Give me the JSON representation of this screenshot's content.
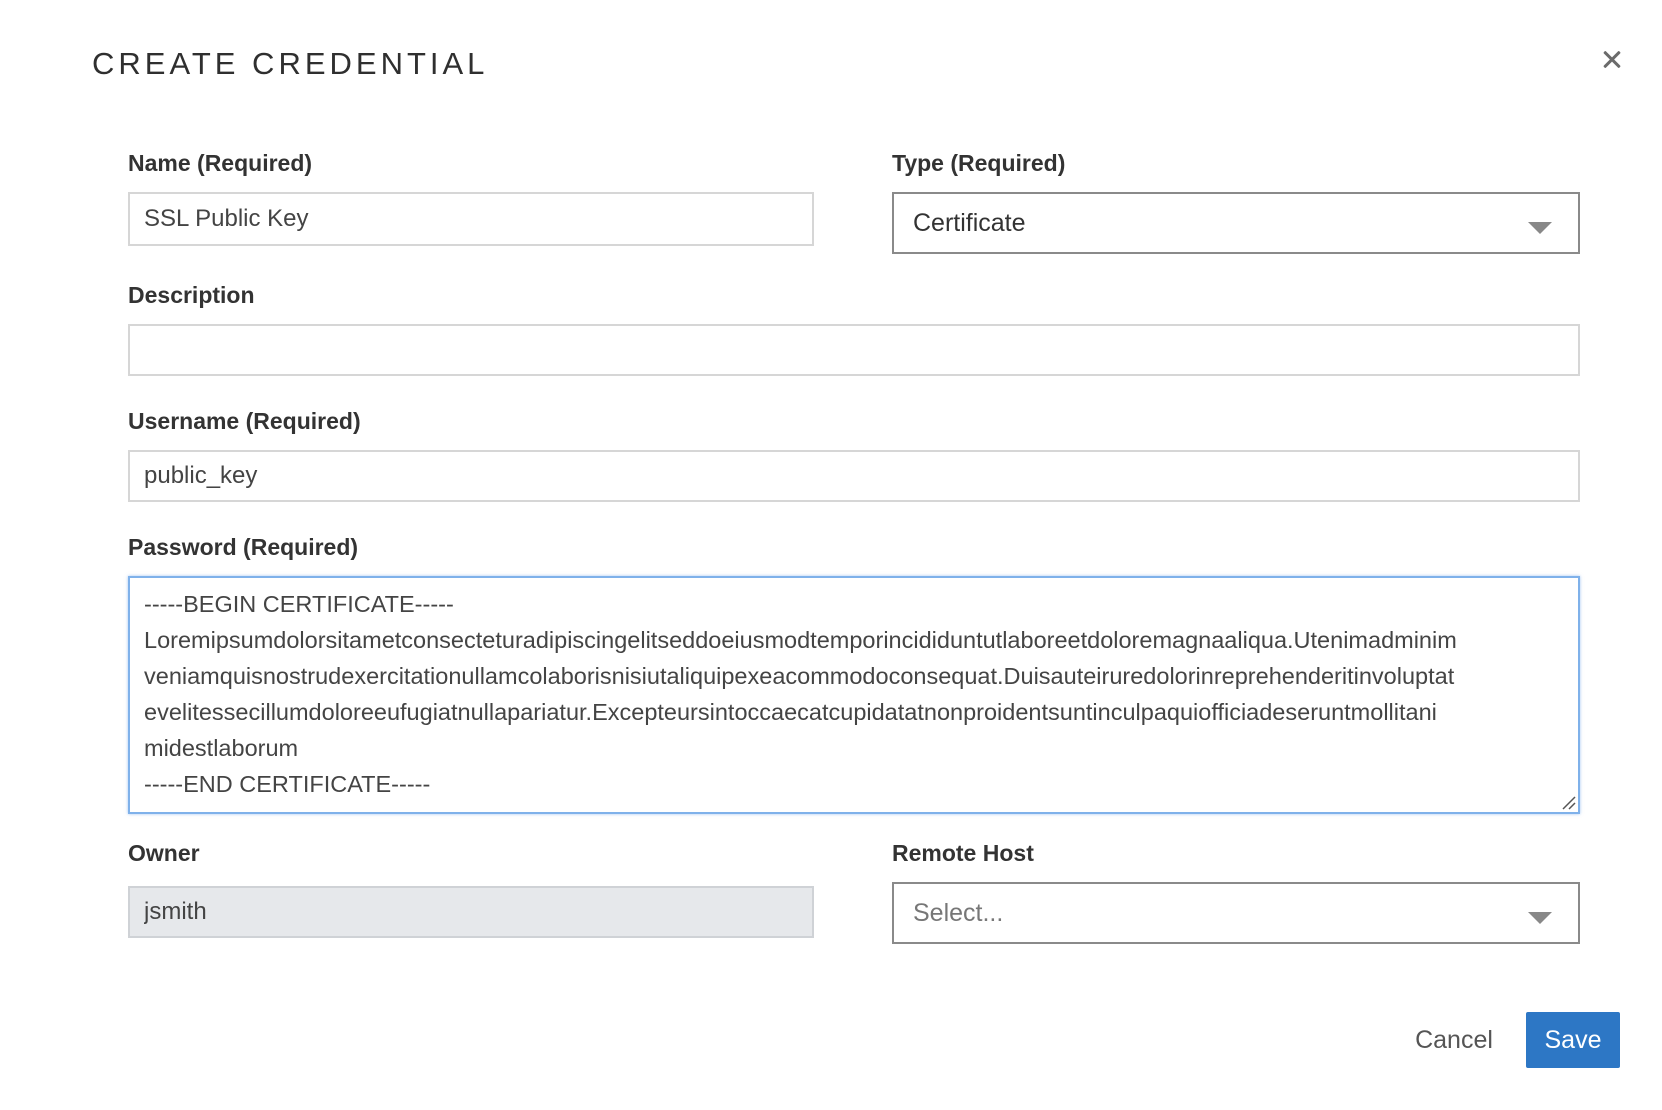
{
  "dialog": {
    "title": "CREATE CREDENTIAL",
    "close_icon": "close-icon"
  },
  "form": {
    "name": {
      "label": "Name (Required)",
      "value": "SSL Public Key"
    },
    "type": {
      "label": "Type (Required)",
      "selected": "Certificate",
      "icon": "chevron-down-icon"
    },
    "description": {
      "label": "Description",
      "value": ""
    },
    "username": {
      "label": "Username (Required)",
      "value": "public_key"
    },
    "password": {
      "label": "Password (Required)",
      "lines": [
        "-----BEGIN CERTIFICATE-----",
        "Loremipsumdolorsitametconsecteturadipiscingelitseddoeiusmodtemporincididuntutlaboreetdoloremagnaaliqua.Utenimadminim",
        "veniamquisnostrudexercitationullamcolaborisnisiutaliquipexeacommodoconsequat.Duisauteiruredolorinreprehenderitinvoluptat",
        "evelitessecillumdoloreeufugiatnullapariatur.Excepteursintoccaecatcupidatatnonproidentsuntinculpaquiofficiadeseruntmollitani",
        "midestlaborum",
        "-----END CERTIFICATE-----"
      ]
    },
    "owner": {
      "label": "Owner",
      "value": "jsmith"
    },
    "remote_host": {
      "label": "Remote Host",
      "placeholder": "Select...",
      "icon": "chevron-down-icon"
    }
  },
  "actions": {
    "cancel_label": "Cancel",
    "save_label": "Save"
  },
  "colors": {
    "primary": "#2d77c5",
    "focus_border": "#7fb1ea",
    "readonly_bg": "#e6e8eb"
  }
}
